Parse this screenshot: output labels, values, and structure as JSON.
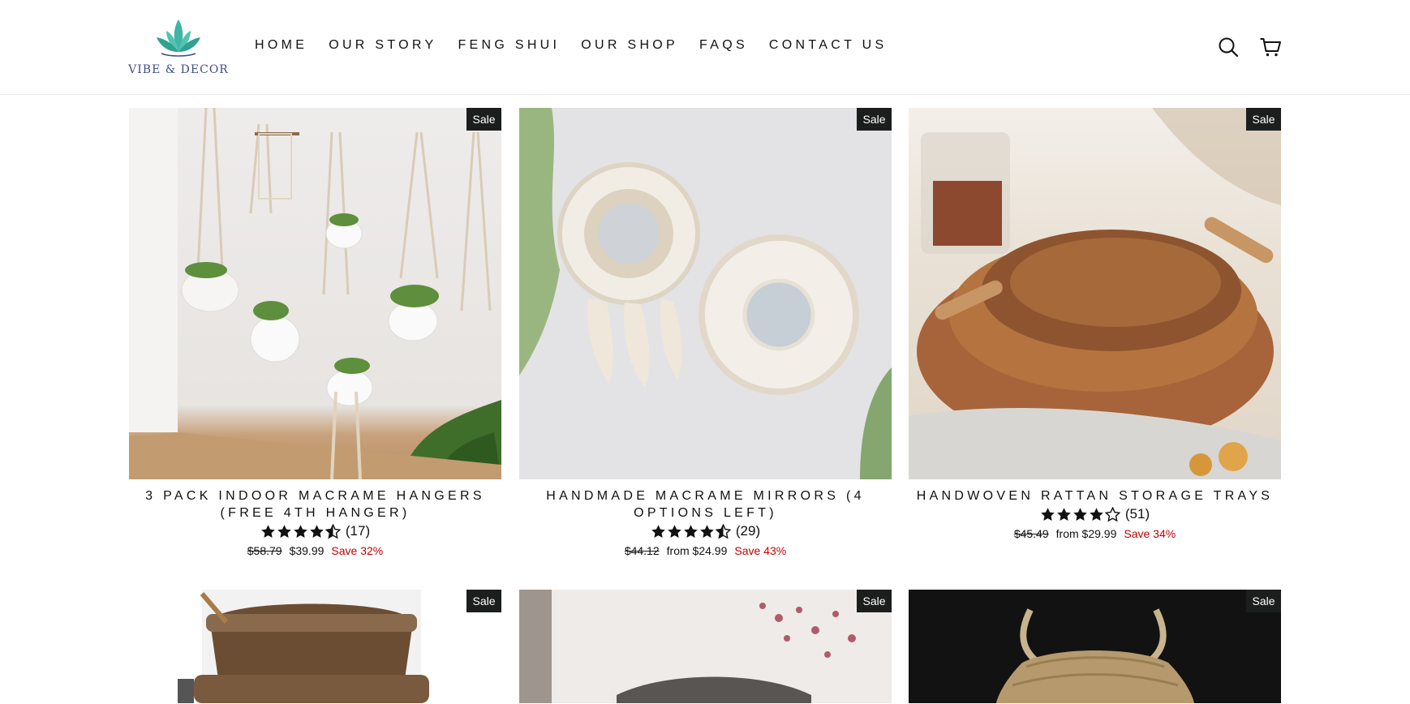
{
  "brand": {
    "name": "VIBE & DECOR",
    "colors": {
      "teal": "#3fb5a6",
      "navy": "#3f4d8a"
    }
  },
  "nav": {
    "items": [
      "HOME",
      "OUR STORY",
      "FENG SHUI",
      "OUR SHOP",
      "FAQS",
      "CONTACT US"
    ]
  },
  "header_icons": [
    "search-icon",
    "cart-icon"
  ],
  "colors": {
    "sale_red": "#c20000",
    "badge_bg": "#1c1d1d"
  },
  "products": [
    {
      "title": "3 PACK INDOOR MACRAME HANGERS (FREE 4TH HANGER)",
      "badge": "Sale",
      "rating": 4.5,
      "reviews": "(17)",
      "original_price": "$58.79",
      "price": "$39.99",
      "save": "Save 32%"
    },
    {
      "title": "HANDMADE MACRAME MIRRORS (4 OPTIONS LEFT)",
      "badge": "Sale",
      "rating": 4.5,
      "reviews": "(29)",
      "original_price": "$44.12",
      "price": "from $24.99",
      "save": "Save 43%"
    },
    {
      "title": "HANDWOVEN RATTAN STORAGE TRAYS",
      "badge": "Sale",
      "rating": 4,
      "reviews": "(51)",
      "original_price": "$45.49",
      "price": "from $29.99",
      "save": "Save 34%"
    },
    {
      "badge": "Sale"
    },
    {
      "badge": "Sale"
    },
    {
      "badge": "Sale"
    }
  ]
}
